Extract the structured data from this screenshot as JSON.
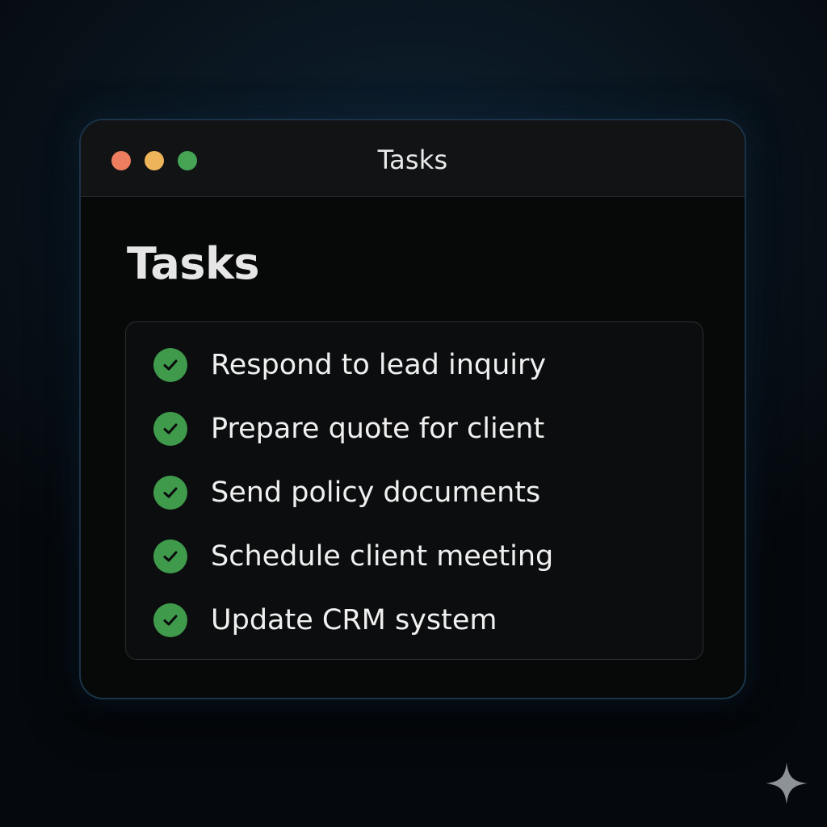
{
  "window": {
    "title": "Tasks",
    "controls": [
      "close",
      "minimize",
      "zoom"
    ]
  },
  "page": {
    "heading": "Tasks"
  },
  "tasks": [
    {
      "label": "Respond to lead inquiry",
      "completed": true,
      "icon": "check-circle-icon"
    },
    {
      "label": "Prepare quote for client",
      "completed": true,
      "icon": "check-circle-icon"
    },
    {
      "label": "Send policy documents",
      "completed": true,
      "icon": "check-circle-icon"
    },
    {
      "label": "Schedule client meeting",
      "completed": true,
      "icon": "check-circle-icon"
    },
    {
      "label": "Update CRM system",
      "completed": true,
      "icon": "check-circle-icon"
    }
  ],
  "colors": {
    "close": "#ed7d5e",
    "minimize": "#eeb45a",
    "zoom": "#46a455",
    "check": "#3f9a4c",
    "accent_border": "#1b3348"
  },
  "decoration": {
    "corner_icon": "sparkle-icon"
  }
}
